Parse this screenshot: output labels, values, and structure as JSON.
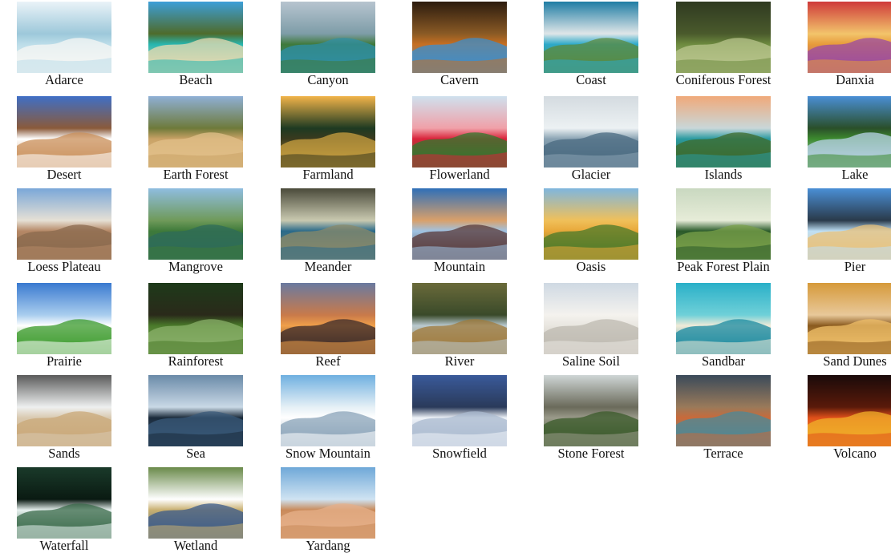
{
  "figure": {
    "columns": 7,
    "items": [
      {
        "label": "Adarce",
        "icon": "adarce-photo",
        "colors": [
          "#eaf3f8",
          "#bcdde9",
          "#f7f7f4",
          "#9dc8da"
        ]
      },
      {
        "label": "Beach",
        "icon": "beach-photo",
        "colors": [
          "#3d9fd8",
          "#27b6b0",
          "#eadbb2",
          "#4e6b2b"
        ]
      },
      {
        "label": "Canyon",
        "icon": "canyon-photo",
        "colors": [
          "#b7c4cf",
          "#3f7a3b",
          "#2f8fa6",
          "#7e9da8"
        ]
      },
      {
        "label": "Cavern",
        "icon": "cavern-photo",
        "colors": [
          "#2c1b0e",
          "#c76f22",
          "#3b8fcf",
          "#8a5a25"
        ]
      },
      {
        "label": "Coast",
        "icon": "coast-photo",
        "colors": [
          "#1f7da4",
          "#2ca9c9",
          "#5b8a3c",
          "#dfe6e8"
        ]
      },
      {
        "label": "Coniferous Forest",
        "icon": "coniferous-forest-photo",
        "colors": [
          "#2f3a21",
          "#6e8b3f",
          "#b9c68d",
          "#4a5a2c"
        ]
      },
      {
        "label": "Danxia",
        "icon": "danxia-photo",
        "colors": [
          "#cf3a3a",
          "#e79a3a",
          "#9a4aa3",
          "#f2c46b"
        ]
      },
      {
        "label": "Desert",
        "icon": "desert-photo",
        "colors": [
          "#3f6fc6",
          "#ffffff",
          "#c98f59",
          "#8a5a3a"
        ]
      },
      {
        "label": "Earth Forest",
        "icon": "earth-forest-photo",
        "colors": [
          "#8fb0d6",
          "#c9a266",
          "#e1c08a",
          "#6e7a3a"
        ]
      },
      {
        "label": "Farmland",
        "icon": "farmland-photo",
        "colors": [
          "#f2b44a",
          "#3a3a1e",
          "#c9a040",
          "#1e3a22"
        ]
      },
      {
        "label": "Flowerland",
        "icon": "flowerland-photo",
        "colors": [
          "#cfe1ee",
          "#d9233a",
          "#2d7a2e",
          "#f0a0a8"
        ]
      },
      {
        "label": "Glacier",
        "icon": "glacier-photo",
        "colors": [
          "#d4dbe0",
          "#8aa3b3",
          "#4a6a80",
          "#ecf1f3"
        ]
      },
      {
        "label": "Islands",
        "icon": "islands-photo",
        "colors": [
          "#f0a97a",
          "#2a9aa0",
          "#3d6a2a",
          "#c9d7d9"
        ]
      },
      {
        "label": "Lake",
        "icon": "lake-photo",
        "colors": [
          "#4a8fd6",
          "#3c8a2e",
          "#b9d3e9",
          "#2a4f2a"
        ]
      },
      {
        "label": "Loess Plateau",
        "icon": "loess-plateau-photo",
        "colors": [
          "#7aa7d8",
          "#b58866",
          "#8a6a4e",
          "#e6e0d5"
        ]
      },
      {
        "label": "Mangrove",
        "icon": "mangrove-photo",
        "colors": [
          "#8fbde0",
          "#3e7a3a",
          "#2d6b5a",
          "#6f9a5a"
        ]
      },
      {
        "label": "Meander",
        "icon": "meander-photo",
        "colors": [
          "#4a4a3a",
          "#2a6a8a",
          "#8a8a6a",
          "#c9c9b0"
        ]
      },
      {
        "label": "Mountain",
        "icon": "mountain-photo",
        "colors": [
          "#2e6fb8",
          "#9fc3e3",
          "#5a3a3a",
          "#d9a06a"
        ]
      },
      {
        "label": "Oasis",
        "icon": "oasis-photo",
        "colors": [
          "#7fb6de",
          "#e8a83a",
          "#4a7a2a",
          "#f0c05a"
        ]
      },
      {
        "label": "Peak Forest Plain",
        "icon": "peak-forest-plain-photo",
        "colors": [
          "#c9d8c0",
          "#2a5a2a",
          "#7aa04a",
          "#e6ecd8"
        ]
      },
      {
        "label": "Pier",
        "icon": "pier-photo",
        "colors": [
          "#4a8fd6",
          "#bfe0f5",
          "#e9c27a",
          "#2a3a4a"
        ]
      },
      {
        "label": "Prairie",
        "icon": "prairie-photo",
        "colors": [
          "#3a7ad0",
          "#ffffff",
          "#3a9a2a",
          "#a9cdee"
        ]
      },
      {
        "label": "Rainforest",
        "icon": "rainforest-photo",
        "colors": [
          "#1e3a1a",
          "#4a7a2a",
          "#8ab06a",
          "#2a2a1a"
        ]
      },
      {
        "label": "Reef",
        "icon": "reef-photo",
        "colors": [
          "#6a7aa0",
          "#f0a04a",
          "#3a2a2a",
          "#c97a4a"
        ]
      },
      {
        "label": "River",
        "icon": "river-photo",
        "colors": [
          "#6a6a3a",
          "#b9c9cf",
          "#a07a3a",
          "#3a4a2a"
        ]
      },
      {
        "label": "Saline Soil",
        "icon": "saline-soil-photo",
        "colors": [
          "#cfd9e3",
          "#e9e6e0",
          "#bdb9b0",
          "#f4f2ee"
        ]
      },
      {
        "label": "Sandbar",
        "icon": "sandbar-photo",
        "colors": [
          "#2ab0c8",
          "#f0ebd8",
          "#1a8aa0",
          "#6fd0d8"
        ]
      },
      {
        "label": "Sand Dunes",
        "icon": "sand-dunes-photo",
        "colors": [
          "#d69a3a",
          "#8a5a1e",
          "#f0c06a",
          "#e8c89a"
        ]
      },
      {
        "label": "Sands",
        "icon": "sands-photo",
        "colors": [
          "#5a5a5a",
          "#d9c9b0",
          "#c9a878",
          "#eef0f0"
        ]
      },
      {
        "label": "Sea",
        "icon": "sea-photo",
        "colors": [
          "#6a8aa8",
          "#1a2a3a",
          "#3a5a7a",
          "#c9d9e6"
        ]
      },
      {
        "label": "Snow Mountain",
        "icon": "snow-mountain-photo",
        "colors": [
          "#6fb0e0",
          "#ffffff",
          "#8aa3b8",
          "#e6f0f6"
        ]
      },
      {
        "label": "Snowfield",
        "icon": "snowfield-photo",
        "colors": [
          "#3a5a9a",
          "#eef2f8",
          "#a9b9cf",
          "#2a3a5a"
        ]
      },
      {
        "label": "Stone Forest",
        "icon": "stone-forest-photo",
        "colors": [
          "#cfd6d6",
          "#9a9a8a",
          "#3a5a2a",
          "#6a6a5a"
        ]
      },
      {
        "label": "Terrace",
        "icon": "terrace-photo",
        "colors": [
          "#3a4a5a",
          "#c96a3a",
          "#4a8a9a",
          "#9a7a5a"
        ]
      },
      {
        "label": "Volcano",
        "icon": "volcano-photo",
        "colors": [
          "#1a0a0a",
          "#e0501a",
          "#f0b02a",
          "#5a1a0a"
        ]
      },
      {
        "label": "Waterfall",
        "icon": "waterfall-photo",
        "colors": [
          "#1a3a2a",
          "#e6f0ee",
          "#3a6a4a",
          "#0a1a12"
        ]
      },
      {
        "label": "Wetland",
        "icon": "wetland-photo",
        "colors": [
          "#6a8a4a",
          "#c9b070",
          "#3a5a8a",
          "#ffffff"
        ]
      },
      {
        "label": "Yardang",
        "icon": "yardang-photo",
        "colors": [
          "#6fa8d8",
          "#c98a5a",
          "#e6b08a",
          "#cfe3f2"
        ]
      }
    ]
  }
}
